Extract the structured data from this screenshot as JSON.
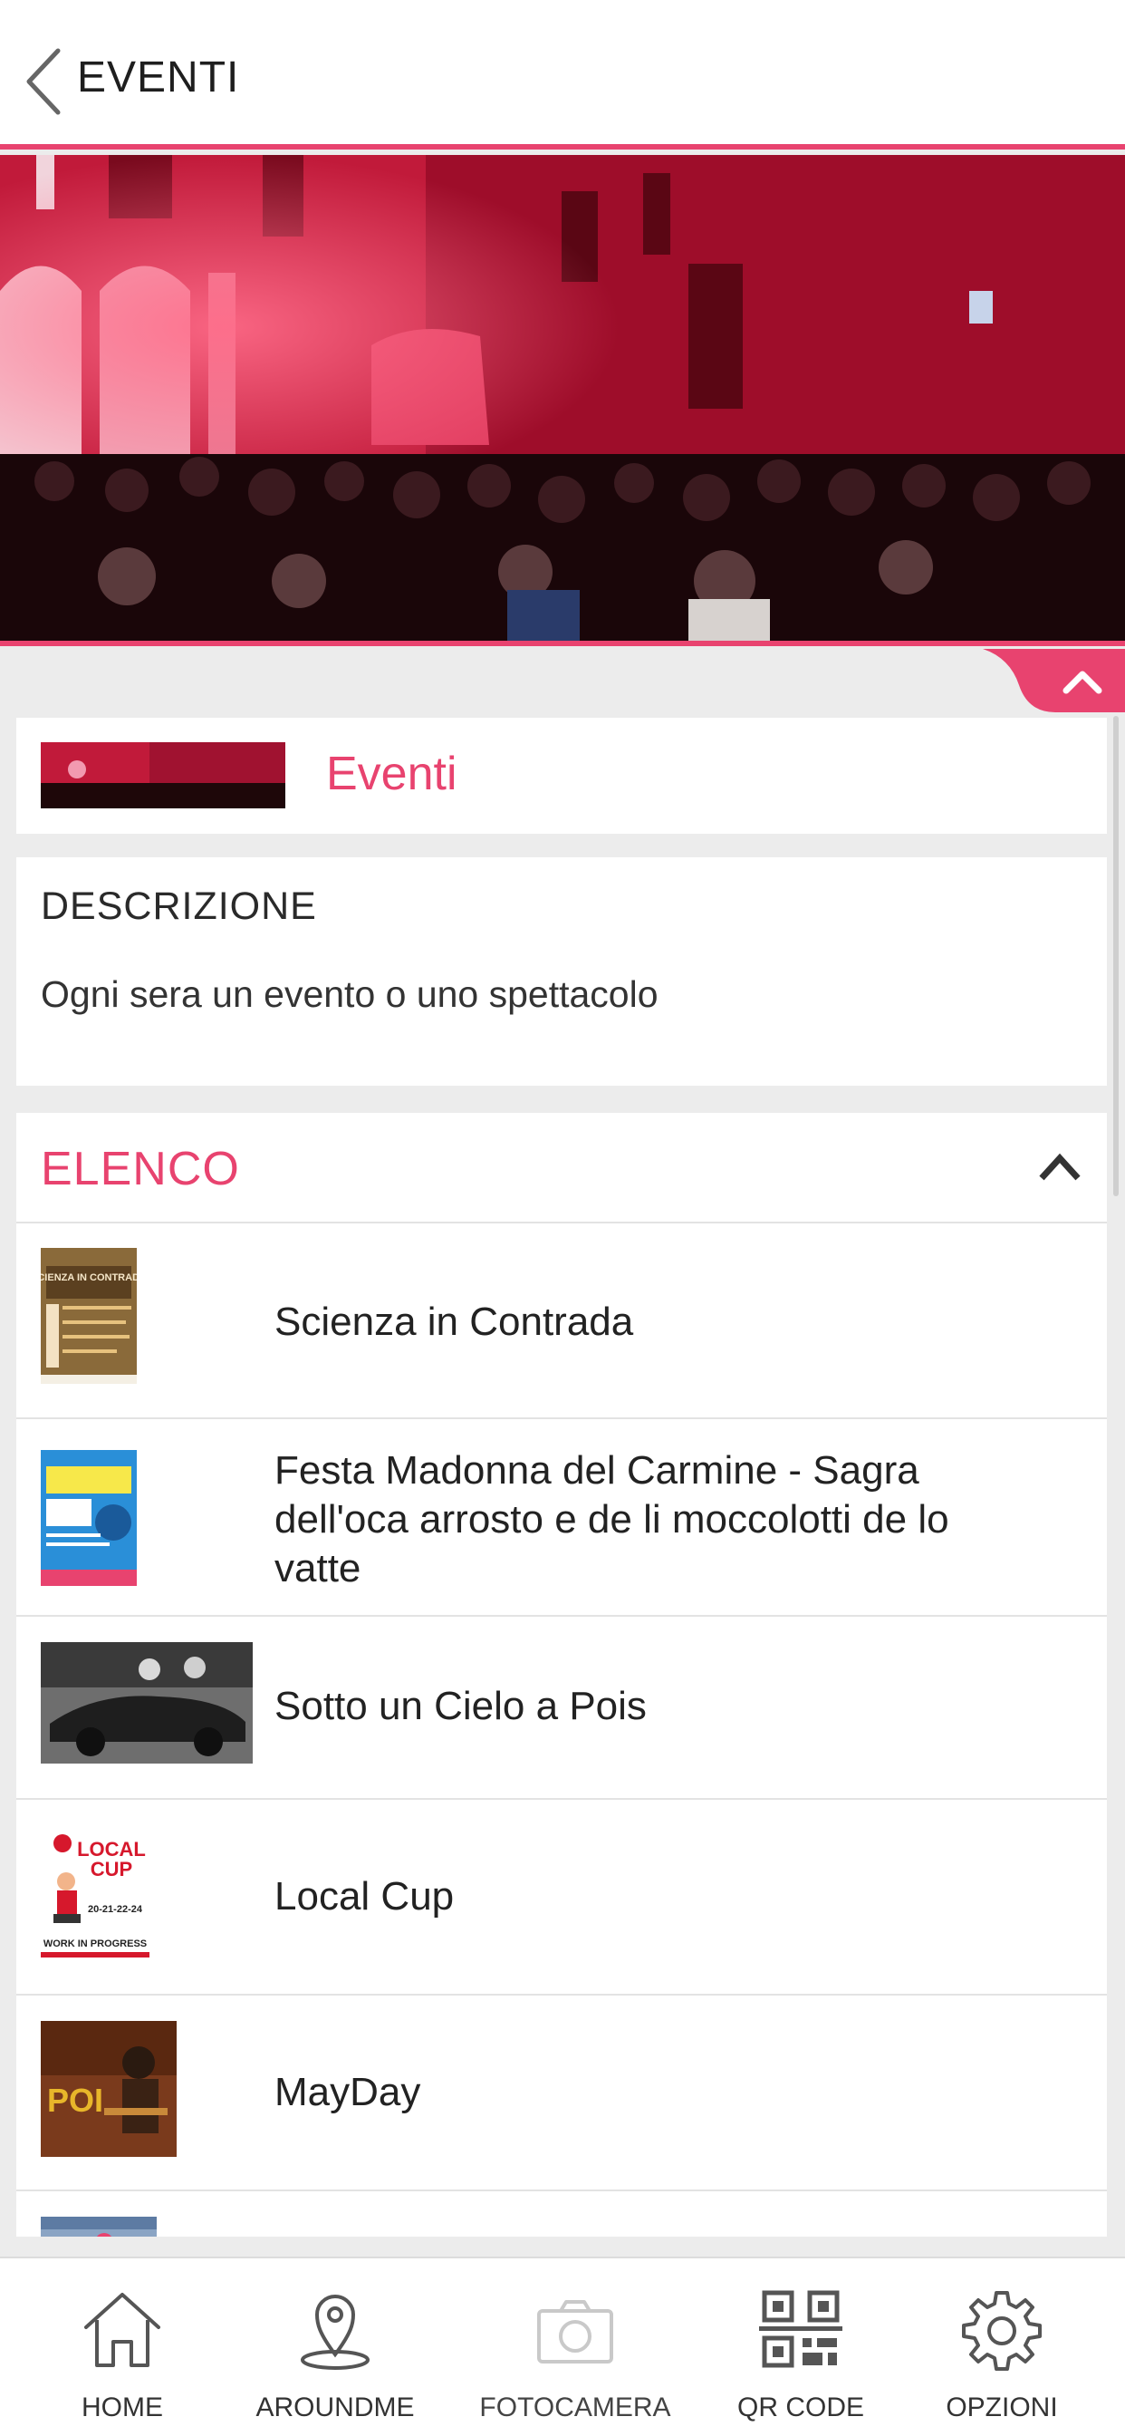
{
  "header": {
    "title": "EVENTI",
    "back_icon": "chevron-left-icon"
  },
  "hero": {
    "image": "evening-concert-photo"
  },
  "title_card": {
    "title": "Eventi"
  },
  "description": {
    "heading": "DESCRIZIONE",
    "text": "Ogni sera un evento o uno spettacolo"
  },
  "list": {
    "title": "ELENCO",
    "items": [
      {
        "label": "Scienza in Contrada"
      },
      {
        "label": "Festa Madonna del Carmine - Sagra dell'oca arrosto e de li moccolotti de lo vatte"
      },
      {
        "label": "Sotto un Cielo a Pois"
      },
      {
        "label": "Local Cup"
      },
      {
        "label": "MayDay"
      }
    ],
    "thumb_texts": {
      "scienza": "SCIENZA IN CONTRADA",
      "localcup_top": "LOCAL",
      "localcup_bottom": "CUP",
      "localcup_dates": "20-21-22-24",
      "localcup_wip": "WORK IN PROGRESS",
      "mayday": "POI"
    }
  },
  "nav": {
    "items": [
      {
        "label": "HOME",
        "icon": "home-icon"
      },
      {
        "label": "AROUNDME",
        "icon": "location-pin-icon"
      },
      {
        "label": "FOTOCAMERA",
        "icon": "camera-icon"
      },
      {
        "label": "QR CODE",
        "icon": "qr-code-icon"
      },
      {
        "label": "OPZIONI",
        "icon": "gear-icon"
      }
    ]
  },
  "colors": {
    "accent": "#e8436f",
    "background": "#ececec",
    "card": "#ffffff"
  }
}
